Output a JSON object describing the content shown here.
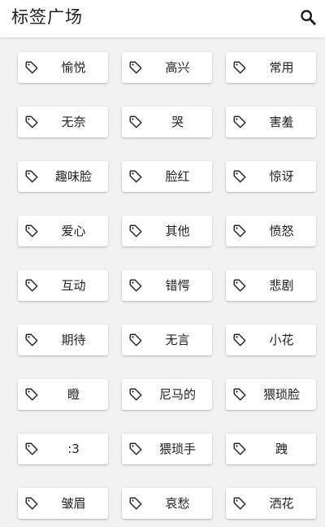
{
  "header": {
    "title": "标签广场",
    "search_icon": "search-icon"
  },
  "tags": [
    {
      "label": "愉悦",
      "icon": "tag-icon"
    },
    {
      "label": "高兴",
      "icon": "tag-icon"
    },
    {
      "label": "常用",
      "icon": "tag-icon"
    },
    {
      "label": "无奈",
      "icon": "tag-icon"
    },
    {
      "label": "哭",
      "icon": "tag-icon"
    },
    {
      "label": "害羞",
      "icon": "tag-icon"
    },
    {
      "label": "趣味脸",
      "icon": "tag-icon"
    },
    {
      "label": "脸红",
      "icon": "tag-icon"
    },
    {
      "label": "惊讶",
      "icon": "tag-icon"
    },
    {
      "label": "爱心",
      "icon": "tag-icon"
    },
    {
      "label": "其他",
      "icon": "tag-icon"
    },
    {
      "label": "愤怒",
      "icon": "tag-icon"
    },
    {
      "label": "互动",
      "icon": "tag-icon"
    },
    {
      "label": "错愕",
      "icon": "tag-icon"
    },
    {
      "label": "悲剧",
      "icon": "tag-icon"
    },
    {
      "label": "期待",
      "icon": "tag-icon"
    },
    {
      "label": "无言",
      "icon": "tag-icon"
    },
    {
      "label": "小花",
      "icon": "tag-icon"
    },
    {
      "label": "瞪",
      "icon": "tag-icon"
    },
    {
      "label": "尼马的",
      "icon": "tag-icon"
    },
    {
      "label": "猥琐脸",
      "icon": "tag-icon"
    },
    {
      "label": ":3",
      "icon": "tag-icon"
    },
    {
      "label": "猥琐手",
      "icon": "tag-icon"
    },
    {
      "label": "跩",
      "icon": "tag-icon"
    },
    {
      "label": "皱眉",
      "icon": "tag-icon"
    },
    {
      "label": "哀愁",
      "icon": "tag-icon"
    },
    {
      "label": "洒花",
      "icon": "tag-icon"
    }
  ],
  "colors": {
    "background": "#f2f2f2",
    "header_bg": "#ffffff",
    "chip_bg": "#ffffff",
    "text": "#222222"
  }
}
